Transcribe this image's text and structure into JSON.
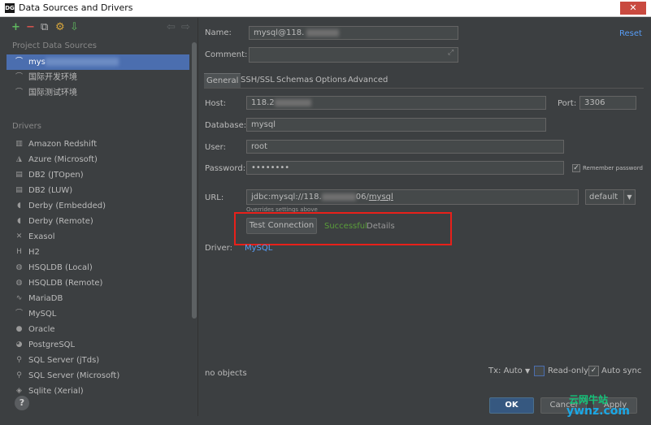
{
  "window": {
    "title": "Data Sources and Drivers",
    "app_icon": "DG",
    "close": "✕"
  },
  "sidebar": {
    "toolbar": [
      {
        "name": "add-icon",
        "glyph": "+"
      },
      {
        "name": "remove-icon",
        "glyph": "−"
      },
      {
        "name": "copy-icon",
        "glyph": "⧉"
      },
      {
        "name": "properties-icon",
        "glyph": "⚙"
      },
      {
        "name": "import-icon",
        "glyph": "⇩"
      },
      {
        "name": "back-icon",
        "glyph": "⇦"
      },
      {
        "name": "forward-icon",
        "glyph": "⇨"
      }
    ],
    "project_section": "Project Data Sources",
    "project_items": [
      {
        "label": "mys",
        "selected": true
      },
      {
        "label": "国际开发环境"
      },
      {
        "label": "国际测试环境"
      }
    ],
    "drivers_section": "Drivers",
    "drivers": [
      {
        "label": "Amazon Redshift",
        "icon": "redshift-icon",
        "glyph": "▥"
      },
      {
        "label": "Azure (Microsoft)",
        "icon": "azure-icon",
        "glyph": "◮"
      },
      {
        "label": "DB2 (JTOpen)",
        "icon": "ibm-icon",
        "glyph": "▤"
      },
      {
        "label": "DB2 (LUW)",
        "icon": "ibm-icon",
        "glyph": "▤"
      },
      {
        "label": "Derby (Embedded)",
        "icon": "derby-icon",
        "glyph": "◖"
      },
      {
        "label": "Derby (Remote)",
        "icon": "derby-icon",
        "glyph": "◖"
      },
      {
        "label": "Exasol",
        "icon": "exasol-icon",
        "glyph": "✕"
      },
      {
        "label": "H2",
        "icon": "h2-icon",
        "glyph": "H"
      },
      {
        "label": "HSQLDB (Local)",
        "icon": "hsqldb-icon",
        "glyph": "◍"
      },
      {
        "label": "HSQLDB (Remote)",
        "icon": "hsqldb-icon",
        "glyph": "◍"
      },
      {
        "label": "MariaDB",
        "icon": "mariadb-icon",
        "glyph": "∿"
      },
      {
        "label": "MySQL",
        "icon": "mysql-icon",
        "glyph": "⌒"
      },
      {
        "label": "Oracle",
        "icon": "oracle-icon",
        "glyph": "●"
      },
      {
        "label": "PostgreSQL",
        "icon": "postgresql-icon",
        "glyph": "◕"
      },
      {
        "label": "SQL Server (jTds)",
        "icon": "sqlserver-icon",
        "glyph": "⚲"
      },
      {
        "label": "SQL Server (Microsoft)",
        "icon": "sqlserver-icon",
        "glyph": "⚲"
      },
      {
        "label": "Sqlite (Xerial)",
        "icon": "sqlite-icon",
        "glyph": "◈"
      }
    ]
  },
  "main": {
    "name_label": "Name:",
    "name_value": "mysql@118.",
    "reset": "Reset",
    "comment_label": "Comment:",
    "comment_value": "",
    "tabs": [
      "General",
      "SSH/SSL",
      "Schemas",
      "Options",
      "Advanced"
    ],
    "host_label": "Host:",
    "host_value": "118.2",
    "port_label": "Port:",
    "port_value": "3306",
    "database_label": "Database:",
    "database_value": "mysql",
    "user_label": "User:",
    "user_value": "root",
    "password_label": "Password:",
    "password_value": "••••••••",
    "remember_password": "Remember password",
    "url_label": "URL:",
    "url_value_prefix": "jdbc:mysql://118.",
    "url_value_suffix": "06/",
    "url_value_db": "mysql",
    "url_mode": "default",
    "overrides": "Overrides settings above",
    "test_connection": "Test Connection",
    "status": "Successful",
    "details": "Details",
    "driver_label": "Driver:",
    "driver_value": "MySQL",
    "objects": "no objects",
    "tx": "Tx: Auto",
    "read_only": "Read-only",
    "auto_sync": "Auto sync",
    "ok": "OK",
    "cancel": "Cancel",
    "apply": "Apply"
  },
  "help": "?",
  "watermark": {
    "line1": "云网牛站",
    "line2": "ywnz.com"
  },
  "colors": {
    "accent": "#4b6eaf",
    "success": "#5a9e3a",
    "link": "#589df6",
    "highlight_box": "#e8201a"
  }
}
